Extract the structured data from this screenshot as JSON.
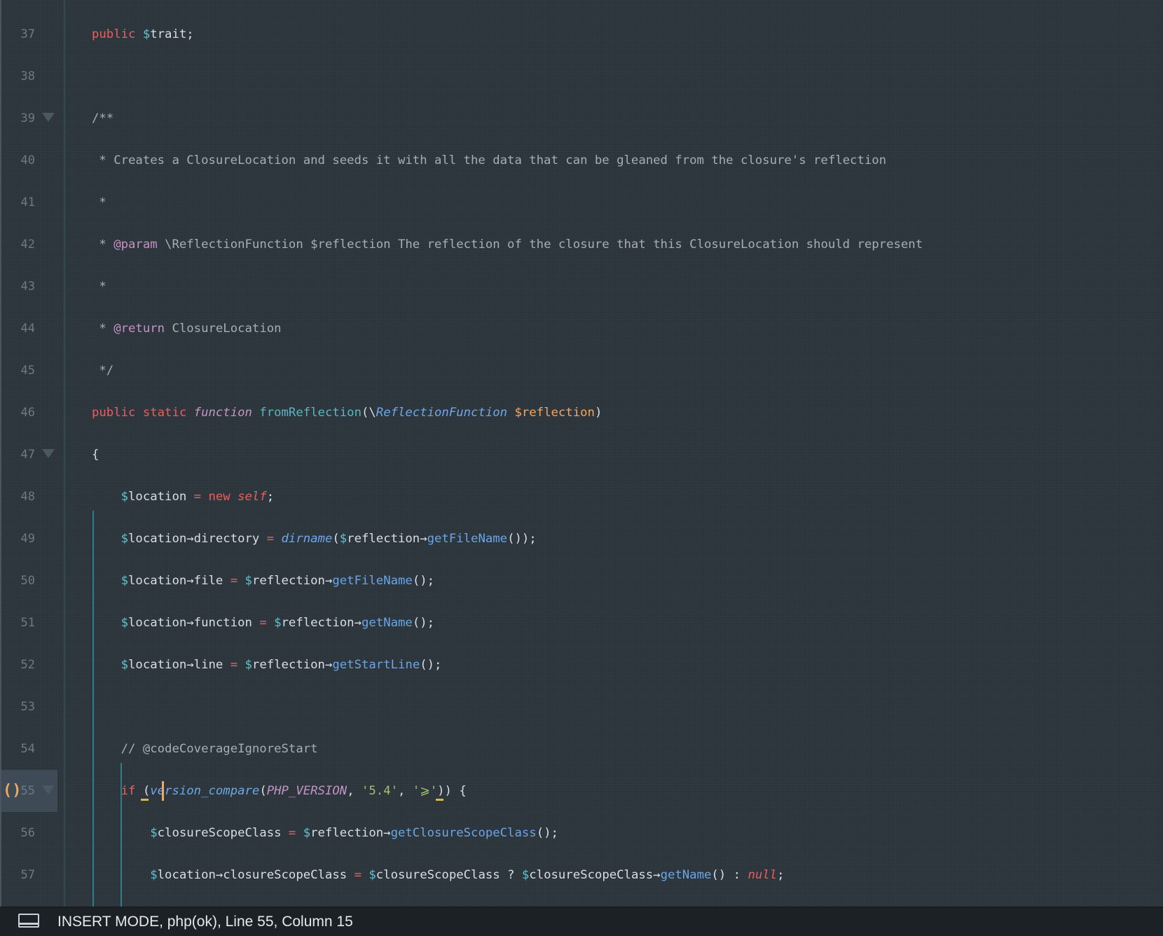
{
  "editor": {
    "lines": [
      {
        "n": "37",
        "tokens": [
          [
            "kw",
            "public "
          ],
          [
            "var",
            "$"
          ],
          [
            "",
            "trait;"
          ]
        ]
      },
      {
        "n": "38",
        "tokens": []
      },
      {
        "n": "39",
        "fold": true,
        "tokens": [
          [
            "cm",
            "/**"
          ]
        ]
      },
      {
        "n": "40",
        "tokens": [
          [
            "cm",
            " * Creates a ClosureLocation and seeds it with all the data that can be gleaned from the closure's reflection"
          ]
        ]
      },
      {
        "n": "41",
        "tokens": [
          [
            "cm",
            " *"
          ]
        ]
      },
      {
        "n": "42",
        "tokens": [
          [
            "cm",
            " * "
          ],
          [
            "tag",
            "@param"
          ],
          [
            "cm",
            " \\ReflectionFunction $reflection The reflection of the closure that this ClosureLocation should represent"
          ]
        ]
      },
      {
        "n": "43",
        "tokens": [
          [
            "cm",
            " *"
          ]
        ]
      },
      {
        "n": "44",
        "tokens": [
          [
            "cm",
            " * "
          ],
          [
            "tag",
            "@return"
          ],
          [
            "cm",
            " ClosureLocation"
          ]
        ]
      },
      {
        "n": "45",
        "tokens": [
          [
            "cm",
            " */"
          ]
        ]
      },
      {
        "n": "46",
        "tokens": [
          [
            "kw",
            "public static "
          ],
          [
            "fn",
            "function"
          ],
          [
            "",
            ""
          ],
          [
            "method",
            " fromReflection"
          ],
          [
            "",
            "(\\"
          ],
          [
            "cls",
            "ReflectionFunction"
          ],
          [
            "pm",
            " $reflection"
          ],
          [
            "",
            ")"
          ]
        ]
      },
      {
        "n": "47",
        "fold": true,
        "tokens": [
          [
            "",
            "{"
          ]
        ]
      },
      {
        "n": "48",
        "tokens": [
          [
            "",
            "    "
          ],
          [
            "var",
            "$"
          ],
          [
            "",
            "location "
          ],
          [
            "op",
            "="
          ],
          [
            "kw",
            " new "
          ],
          [
            "null",
            "self"
          ],
          [
            "",
            ";"
          ]
        ]
      },
      {
        "n": "49",
        "tokens": [
          [
            "",
            "    "
          ],
          [
            "var",
            "$"
          ],
          [
            "",
            "location→directory "
          ],
          [
            "op",
            "="
          ],
          [
            "",
            ""
          ],
          [
            "cls",
            " dirname"
          ],
          [
            "",
            "("
          ],
          [
            "var",
            "$"
          ],
          [
            "",
            "reflection→"
          ],
          [
            "call",
            "getFileName"
          ],
          [
            "",
            "());"
          ]
        ]
      },
      {
        "n": "50",
        "tokens": [
          [
            "",
            "    "
          ],
          [
            "var",
            "$"
          ],
          [
            "",
            "location→file "
          ],
          [
            "op",
            "="
          ],
          [
            "var",
            " $"
          ],
          [
            "",
            "reflection→"
          ],
          [
            "call",
            "getFileName"
          ],
          [
            "",
            "();"
          ]
        ]
      },
      {
        "n": "51",
        "tokens": [
          [
            "",
            "    "
          ],
          [
            "var",
            "$"
          ],
          [
            "",
            "location→function "
          ],
          [
            "op",
            "="
          ],
          [
            "var",
            " $"
          ],
          [
            "",
            "reflection→"
          ],
          [
            "call",
            "getName"
          ],
          [
            "",
            "();"
          ]
        ]
      },
      {
        "n": "52",
        "tokens": [
          [
            "",
            "    "
          ],
          [
            "var",
            "$"
          ],
          [
            "",
            "location→line "
          ],
          [
            "op",
            "="
          ],
          [
            "var",
            " $"
          ],
          [
            "",
            "reflection→"
          ],
          [
            "call",
            "getStartLine"
          ],
          [
            "",
            "();"
          ]
        ]
      },
      {
        "n": "53",
        "tokens": []
      },
      {
        "n": "54",
        "tokens": [
          [
            "",
            "    "
          ],
          [
            "cm",
            "// @codeCoverageIgnoreStart"
          ]
        ]
      },
      {
        "n": "55",
        "fold": true,
        "active": true,
        "tokens": [
          [
            "",
            "    "
          ],
          [
            "kw",
            "if"
          ],
          [
            "",
            " ("
          ],
          [
            "cls",
            "version_compare"
          ],
          [
            "",
            "("
          ],
          [
            "const",
            "PHP_VERSION"
          ],
          [
            "",
            ", "
          ],
          [
            "str",
            "'5.4'"
          ],
          [
            "",
            ", "
          ],
          [
            "str",
            "'⩾'"
          ],
          [
            "",
            ")) {"
          ]
        ]
      },
      {
        "n": "56",
        "tokens": [
          [
            "",
            "        "
          ],
          [
            "var",
            "$"
          ],
          [
            "",
            "closureScopeClass "
          ],
          [
            "op",
            "="
          ],
          [
            "var",
            " $"
          ],
          [
            "",
            "reflection→"
          ],
          [
            "call",
            "getClosureScopeClass"
          ],
          [
            "",
            "();"
          ]
        ]
      },
      {
        "n": "57",
        "tokens": [
          [
            "",
            "        "
          ],
          [
            "var",
            "$"
          ],
          [
            "",
            "location→closureScopeClass "
          ],
          [
            "op",
            "="
          ],
          [
            "var",
            " $"
          ],
          [
            "",
            "closureScopeClass ? "
          ],
          [
            "var",
            "$"
          ],
          [
            "",
            "closureScopeClass→"
          ],
          [
            "call",
            "getName"
          ],
          [
            "",
            "() : "
          ],
          [
            "null",
            "null"
          ],
          [
            "",
            ";"
          ]
        ]
      }
    ],
    "bracket_marker": "()"
  },
  "status": {
    "text": "INSERT MODE, php(ok), Line 55, Column 15",
    "icon": "panel-toggle-icon"
  }
}
